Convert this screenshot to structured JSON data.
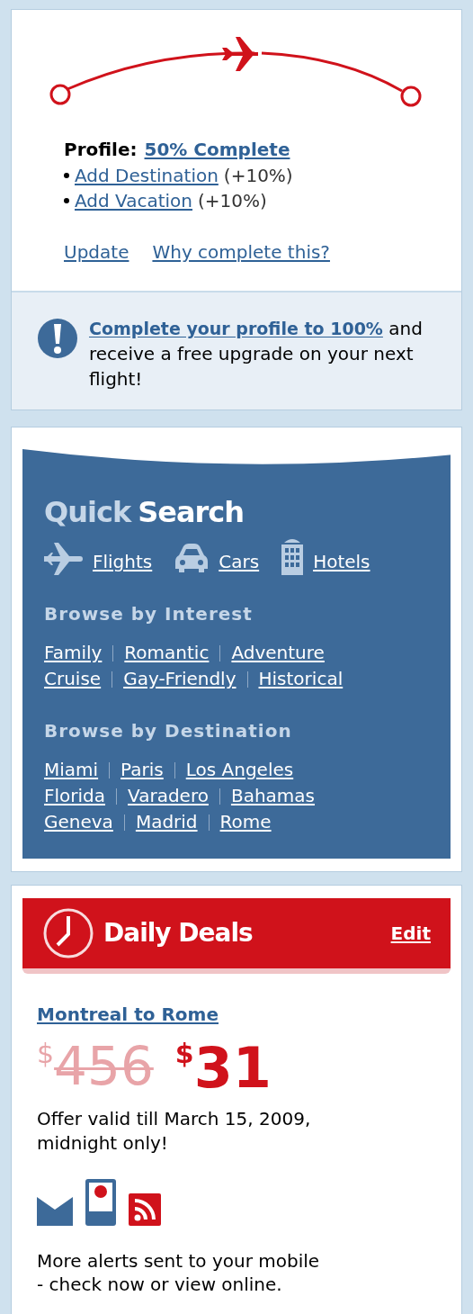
{
  "profile": {
    "label": "Profile:",
    "completion": "50% Complete",
    "tasks": [
      {
        "link": "Add Destination",
        "bonus": "(+10%)"
      },
      {
        "link": "Add Vacation",
        "bonus": "(+10%)"
      }
    ],
    "links": [
      "Update",
      "Why complete this?"
    ]
  },
  "notice": {
    "link": "Complete your profile to 100%",
    "text": "and receive a free upgrade on your next flight!"
  },
  "quick_search": {
    "title_muted": "Quick",
    "title": "Search",
    "categories": [
      {
        "kind": "flights",
        "label": "Flights"
      },
      {
        "kind": "cars",
        "label": "Cars"
      },
      {
        "kind": "hotels",
        "label": "Hotels"
      }
    ],
    "sections": [
      {
        "heading": "Browse by Interest",
        "rows": [
          [
            "Family",
            "Romantic",
            "Adventure"
          ],
          [
            "Cruise",
            "Gay-Friendly",
            "Historical"
          ]
        ]
      },
      {
        "heading": "Browse by Destination",
        "rows": [
          [
            "Miami",
            "Paris",
            "Los Angeles"
          ],
          [
            "Florida",
            "Varadero",
            "Bahamas"
          ],
          [
            "Geneva",
            "Madrid",
            "Rome"
          ]
        ]
      }
    ]
  },
  "daily_deals": {
    "title": "Daily Deals",
    "edit": "Edit",
    "route": "Montreal to Rome",
    "old_price": {
      "currency": "$",
      "amount": "456"
    },
    "new_price": {
      "currency": "$",
      "amount": "31"
    },
    "validity": [
      "Offer valid till March 15, 2009,",
      "midnight only!"
    ],
    "alerts": [
      {
        "kind": "email"
      },
      {
        "kind": "mobile"
      },
      {
        "kind": "rss"
      }
    ],
    "alerts_text": [
      "More alerts sent to your mobile",
      "- check now or view online."
    ]
  }
}
